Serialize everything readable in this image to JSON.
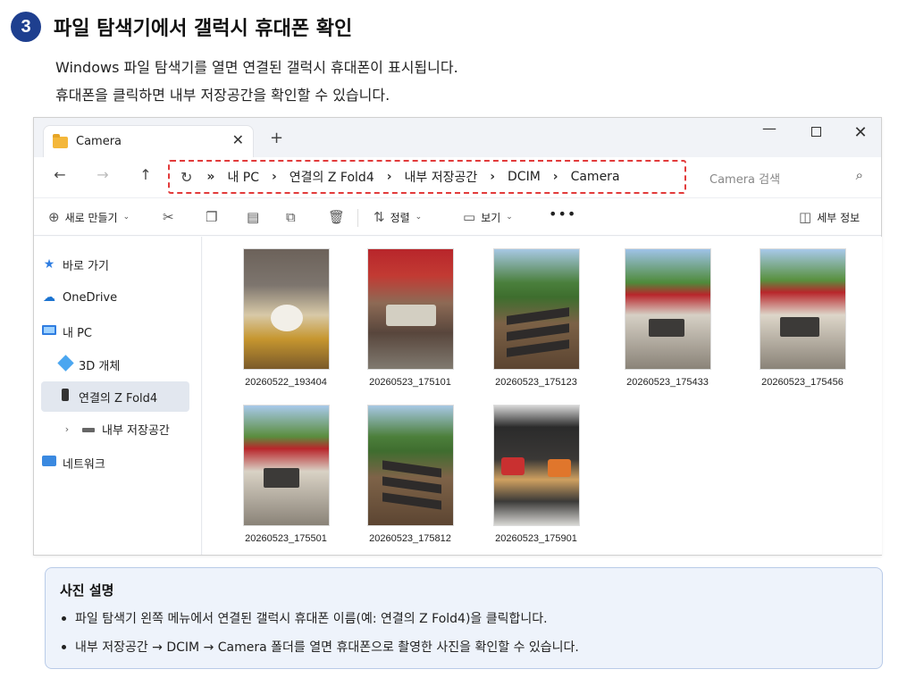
{
  "step": {
    "number": "3",
    "title": "파일 탐색기에서 갤럭시 휴대폰 확인"
  },
  "description": [
    "Windows 파일 탐색기를 열면 연결된 갤럭시 휴대폰이 표시됩니다.",
    "휴대폰을 클릭하면 내부 저장공간을 확인할 수 있습니다."
  ],
  "window": {
    "tab_label": "Camera",
    "tab_close": "✕",
    "new_tab": "+",
    "controls": {
      "minimize": "—",
      "maximize": "",
      "close": "✕"
    }
  },
  "nav": {
    "back": "←",
    "forward": "→",
    "up": "↑",
    "refresh": "↻",
    "chevron": "»",
    "separator": "›",
    "breadcrumb": [
      "내 PC",
      "연결의 Z Fold4",
      "내부 저장공간",
      "DCIM",
      "Camera"
    ],
    "search_placeholder": "Camera 검색",
    "search_icon": "⌕"
  },
  "toolbar": {
    "new_label": "새로 만들기",
    "sort_label": "정렬",
    "view_label": "보기",
    "more": "•••",
    "details_label": "세부 정보"
  },
  "sidebar": {
    "items": [
      {
        "label": "바로 가기",
        "icon": "star-icon"
      },
      {
        "label": "OneDrive",
        "icon": "cloud-icon"
      },
      {
        "label": "내 PC",
        "icon": "computer-icon"
      },
      {
        "label": "3D 개체",
        "icon": "cube-icon"
      },
      {
        "label": "연결의 Z Fold4",
        "icon": "phone-icon",
        "selected": true
      },
      {
        "label": "내부 저장공간",
        "icon": "drive-icon",
        "expander": "›"
      },
      {
        "label": "네트워크",
        "icon": "network-icon"
      }
    ]
  },
  "files": [
    "20260522_193404",
    "20260523_175101",
    "20260523_175123",
    "20260523_175433",
    "20260523_175456",
    "20260523_175501",
    "20260523_175812",
    "20260523_175901"
  ],
  "info": {
    "title": "사진 설명",
    "items": [
      "파일 탐색기 왼쪽 메뉴에서 연결된 갤럭시 휴대폰 이름(예: 연결의 Z Fold4)을 클릭합니다.",
      "내부 저장공간 → DCIM → Camera 폴더를 열면 휴대폰으로 촬영한 사진을 확인할 수 있습니다."
    ]
  },
  "colors": {
    "accent": "#1e3f8f",
    "highlight_border": "#e23b3b",
    "info_bg": "#eef3fb"
  }
}
